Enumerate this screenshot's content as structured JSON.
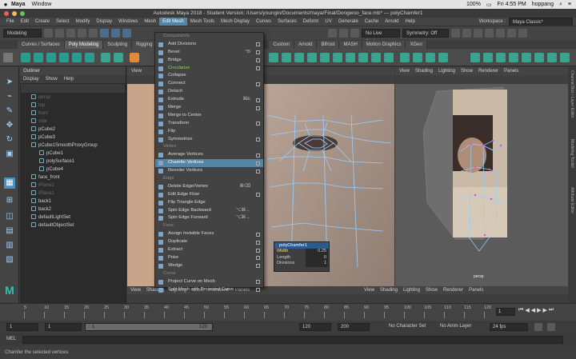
{
  "macbar": {
    "app": "Maya",
    "items": [
      "Window"
    ],
    "battery": "100%",
    "clock": "Fri 4:55 PM",
    "user": "hoppang"
  },
  "titlebar": {
    "title": "Autodesk Maya 2018 - Student Version: /Users/youngin/Documents/maya/Final/Dongwoo_face.mb*   ---   polyChamfer1"
  },
  "maya_menu": {
    "items": [
      "File",
      "Edit",
      "Create",
      "Select",
      "Modify",
      "Display",
      "Windows",
      "Mesh",
      "Edit Mesh",
      "Mesh Tools",
      "Mesh Display",
      "Curves",
      "Surfaces",
      "Deform",
      "UV",
      "Generate",
      "Cache",
      "Arnold",
      "Help"
    ],
    "active_index": 8,
    "workspace_label": "Workspace :",
    "workspace_value": "Maya Classic*"
  },
  "status_line": {
    "mode": "Modeling",
    "live_surface": "No Live Surface",
    "symmetry": "Symmetry: Off"
  },
  "shelf_tabs": [
    "Curves / Surfaces",
    "Poly Modeling",
    "Sculpting",
    "Rigging",
    "Custom",
    "Arnold",
    "Bifrost",
    "MASH",
    "Motion Graphics",
    "XGen"
  ],
  "shelf_active": 1,
  "outliner": {
    "title": "Outliner",
    "menu": [
      "Display",
      "Show",
      "Help"
    ],
    "items": [
      {
        "label": "persp",
        "dim": true,
        "indent": 1
      },
      {
        "label": "top",
        "dim": true,
        "indent": 1
      },
      {
        "label": "front",
        "dim": true,
        "indent": 1
      },
      {
        "label": "side",
        "dim": true,
        "indent": 1
      },
      {
        "label": "pCube2",
        "dim": false,
        "indent": 1
      },
      {
        "label": "pCube3",
        "dim": false,
        "indent": 1
      },
      {
        "label": "pCube1SmoothProxyGroup",
        "dim": false,
        "indent": 1
      },
      {
        "label": "pCube1",
        "dim": false,
        "indent": 2
      },
      {
        "label": "polySurface1",
        "dim": false,
        "indent": 2
      },
      {
        "label": "pCube4",
        "dim": false,
        "indent": 2
      },
      {
        "label": "face_front",
        "dim": false,
        "indent": 1
      },
      {
        "label": "lPlane2",
        "dim": true,
        "indent": 1
      },
      {
        "label": "lPlane1",
        "dim": true,
        "indent": 1
      },
      {
        "label": "back1",
        "dim": false,
        "indent": 1
      },
      {
        "label": "back2",
        "dim": false,
        "indent": 1
      },
      {
        "label": "defaultLightSet",
        "dim": false,
        "indent": 1
      },
      {
        "label": "defaultObjectSet",
        "dim": false,
        "indent": 1
      }
    ]
  },
  "viewport_menu": [
    "View",
    "Shading",
    "Lighting",
    "Show",
    "Renderer",
    "Panels"
  ],
  "viewport_left_menu": [
    "View"
  ],
  "viewport_right_label": "persp",
  "edit_mesh_menu": [
    {
      "label": "Components",
      "type": "section"
    },
    {
      "label": "Add Divisions",
      "box": true
    },
    {
      "label": "Bevel",
      "shortcut": "^B",
      "box": true
    },
    {
      "label": "Bridge",
      "box": true
    },
    {
      "label": "Circularize",
      "box": true,
      "green": true
    },
    {
      "label": "Collapse"
    },
    {
      "label": "Connect",
      "box": true
    },
    {
      "label": "Detach"
    },
    {
      "label": "Extrude",
      "shortcut": "⌘E",
      "box": true
    },
    {
      "label": "Merge",
      "box": true
    },
    {
      "label": "Merge to Center"
    },
    {
      "label": "Transform",
      "box": true
    },
    {
      "label": "Flip"
    },
    {
      "label": "Symmetrize",
      "box": true
    },
    {
      "label": "Vertex",
      "type": "section"
    },
    {
      "label": "Average Vertices",
      "box": true
    },
    {
      "label": "Chamfer Vertices",
      "box": true,
      "highlight": true
    },
    {
      "label": "Reorder Vertices",
      "box": true
    },
    {
      "label": "Edge",
      "type": "section"
    },
    {
      "label": "Delete Edge/Vertex",
      "shortcut": "⌘⌫"
    },
    {
      "label": "Edit Edge Flow",
      "box": true
    },
    {
      "label": "Flip Triangle Edge"
    },
    {
      "label": "Spin Edge Backward",
      "shortcut": "⌥⌘←"
    },
    {
      "label": "Spin Edge Forward",
      "shortcut": "⌥⌘→"
    },
    {
      "label": "Face",
      "type": "section"
    },
    {
      "label": "Assign Invisible Faces",
      "box": true
    },
    {
      "label": "Duplicate",
      "box": true
    },
    {
      "label": "Extract",
      "box": true
    },
    {
      "label": "Poke",
      "box": true
    },
    {
      "label": "Wedge",
      "box": true
    },
    {
      "label": "Curve",
      "type": "section"
    },
    {
      "label": "Project Curve on Mesh",
      "box": true
    },
    {
      "label": "Split Mesh with Projected Curve",
      "box": true
    }
  ],
  "poly_popup": {
    "title": "polyChamfer1",
    "rows": [
      {
        "key": "Width",
        "value": "0.25",
        "yellow": true
      },
      {
        "key": "Length",
        "value": "0"
      },
      {
        "key": "Divisions",
        "value": "1"
      }
    ]
  },
  "timeline": {
    "ticks": [
      "5",
      "10",
      "15",
      "20",
      "25",
      "30",
      "35",
      "40",
      "45",
      "50",
      "55",
      "60",
      "65",
      "70",
      "75",
      "80",
      "85",
      "90",
      "95",
      "100",
      "105",
      "110",
      "115",
      "120"
    ],
    "current": "1"
  },
  "range": {
    "start": "1",
    "inner_start": "1",
    "inner_end": "120",
    "end": "120",
    "max": "200",
    "character_set": "No Character Set",
    "anim_layer": "No Anim Layer",
    "fps": "24 fps"
  },
  "cmd": {
    "label": "MEL"
  },
  "help": {
    "text": "Chamfer the selected vertices"
  },
  "side_tabs": [
    "Channel Box / Layer Editor",
    "Modeling Toolkit",
    "Attribute Editor"
  ]
}
